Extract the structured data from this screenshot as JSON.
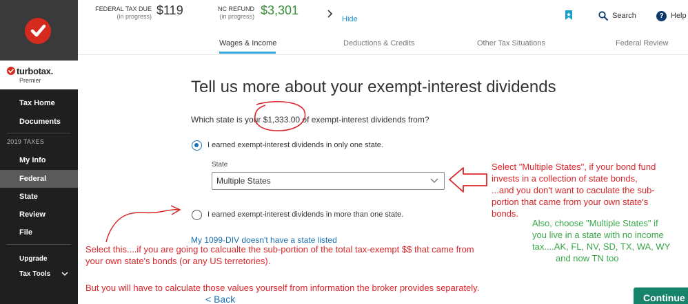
{
  "header": {
    "federal_label": "FEDERAL TAX DUE",
    "federal_sub": "(in progress)",
    "federal_amount": "$119",
    "nc_label": "NC REFUND",
    "nc_sub": "(in progress)",
    "nc_amount": "$3,301",
    "hide": "Hide",
    "search": "Search",
    "help": "Help",
    "help_glyph": "?"
  },
  "sidebar": {
    "brand_name": "turbotax.",
    "edition": "Premier",
    "section_label": "2019 TAXES",
    "items": [
      {
        "label": "Tax Home"
      },
      {
        "label": "Documents"
      },
      {
        "label": "My Info"
      },
      {
        "label": "Federal"
      },
      {
        "label": "State"
      },
      {
        "label": "Review"
      },
      {
        "label": "File"
      },
      {
        "label": "Upgrade"
      },
      {
        "label": "Tax Tools"
      }
    ]
  },
  "tabs": [
    {
      "label": "Wages & Income"
    },
    {
      "label": "Deductions & Credits"
    },
    {
      "label": "Other Tax Situations"
    },
    {
      "label": "Federal Review"
    }
  ],
  "main": {
    "title": "Tell us more about your exempt-interest dividends",
    "question_pre": "Which state is your ",
    "question_amount": "$1,333.00",
    "question_post": " of exempt-interest dividends from?",
    "option_one": "I earned exempt-interest dividends in only one state.",
    "state_label": "State",
    "state_value": "Multiple States",
    "option_multi": "I earned exempt-interest dividends in more than one state.",
    "link_1099": "My 1099-DIV doesn't have a state listed",
    "back": "< Back",
    "continue": "Continue"
  },
  "annotations": {
    "right_red": [
      "Select \"Multiple States\", if your bond fund",
      "invests in a collection of state bonds,",
      "...and you don't want to caculate the sub-",
      "portion that came from your own state's",
      "bonds."
    ],
    "right_green": [
      "Also, choose \"Multiple States\" if",
      "you live in a state with no income",
      "tax....AK, FL, NV, SD, TX, WA, WY",
      "and now TN too"
    ],
    "bottom_red": [
      "Select this....if you are going to calcualte the sub-portion of the total tax-exempt $$ that came from",
      "your own state's bonds (or any US terretories)."
    ],
    "bottom_red_2": "But you will have to calculate those values yourself from information the broker provides separately."
  },
  "colors": {
    "brand_red": "#d52b1e",
    "sidebar_dark": "#1f1f1f",
    "link_blue": "#1a6fb0",
    "refund_green": "#3a8e3a",
    "continue_green": "#16836a",
    "annotation_red": "#d9262a",
    "annotation_green": "#3aa84a"
  }
}
